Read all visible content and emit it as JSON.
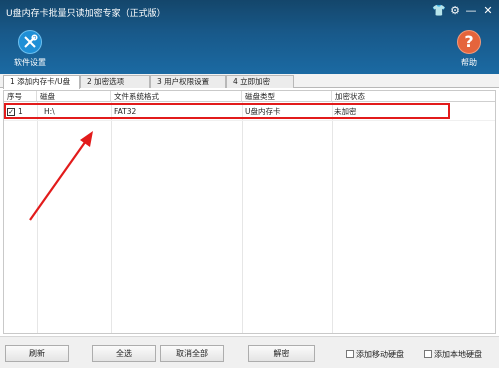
{
  "window": {
    "title": "U盘内存卡批量只读加密专家（正式版）"
  },
  "window_controls": [
    {
      "name": "skin-icon",
      "glyph": "👕"
    },
    {
      "name": "settings-icon",
      "glyph": "⚙"
    },
    {
      "name": "minimize-icon",
      "glyph": "—"
    },
    {
      "name": "close-icon",
      "glyph": "✕"
    }
  ],
  "toolbar": {
    "settings_label": "软件设置",
    "help_label": "帮助",
    "help_glyph": "?"
  },
  "tabs": [
    "1 添加内存卡/U盘",
    "2 加密选项",
    "3 用户权限设置",
    "4 立即加密"
  ],
  "table": {
    "columns": [
      "序号",
      "磁盘",
      "文件系统格式",
      "磁盘类型",
      "加密状态"
    ],
    "rows": [
      {
        "checked": true,
        "check_glyph": "✓",
        "index": "1",
        "disk": "H:\\",
        "fs": "FAT32",
        "type": "U盘内存卡",
        "status": "未加密"
      }
    ]
  },
  "buttons": {
    "refresh": "刷新",
    "select_all": "全选",
    "deselect_all": "取消全部",
    "decrypt": "解密"
  },
  "checkboxes": {
    "add_mobile_hdd": "添加移动硬盘",
    "add_local_hdd": "添加本地硬盘"
  },
  "colors": {
    "header": "#18598a",
    "highlight": "#e21b1b",
    "arrow": "#e21b1b"
  }
}
